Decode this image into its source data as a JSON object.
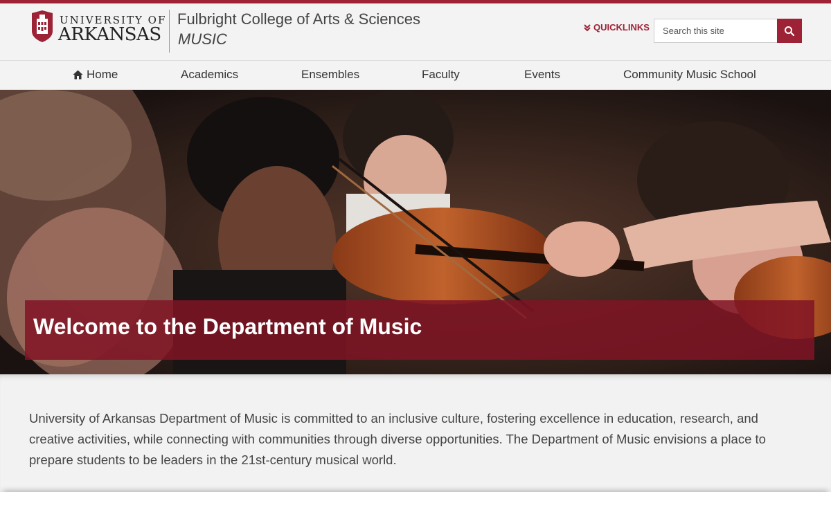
{
  "brand": {
    "university_top": "UNIVERSITY OF",
    "university_main": "ARKANSAS",
    "college": "Fulbright College of Arts & Sciences",
    "department": "MUSIC",
    "accent_color": "#9d2235"
  },
  "quicklinks": {
    "label": "QUICKLINKS",
    "icon": "double-chevron-down-icon"
  },
  "search": {
    "placeholder": "Search this site",
    "value": "",
    "icon": "search-icon"
  },
  "nav": {
    "items": [
      {
        "label": "Home",
        "icon": "home-icon"
      },
      {
        "label": "Academics"
      },
      {
        "label": "Ensembles"
      },
      {
        "label": "Faculty"
      },
      {
        "label": "Events"
      },
      {
        "label": "Community Music School"
      }
    ]
  },
  "hero": {
    "title": "Welcome to the Department of Music"
  },
  "intro": {
    "text": "University of Arkansas Department of Music is committed to an inclusive culture, fostering excellence in education, research, and creative activities, while connecting with communities through diverse opportunities. The Department of Music envisions a place to prepare students to be leaders in the 21st-century musical world."
  }
}
